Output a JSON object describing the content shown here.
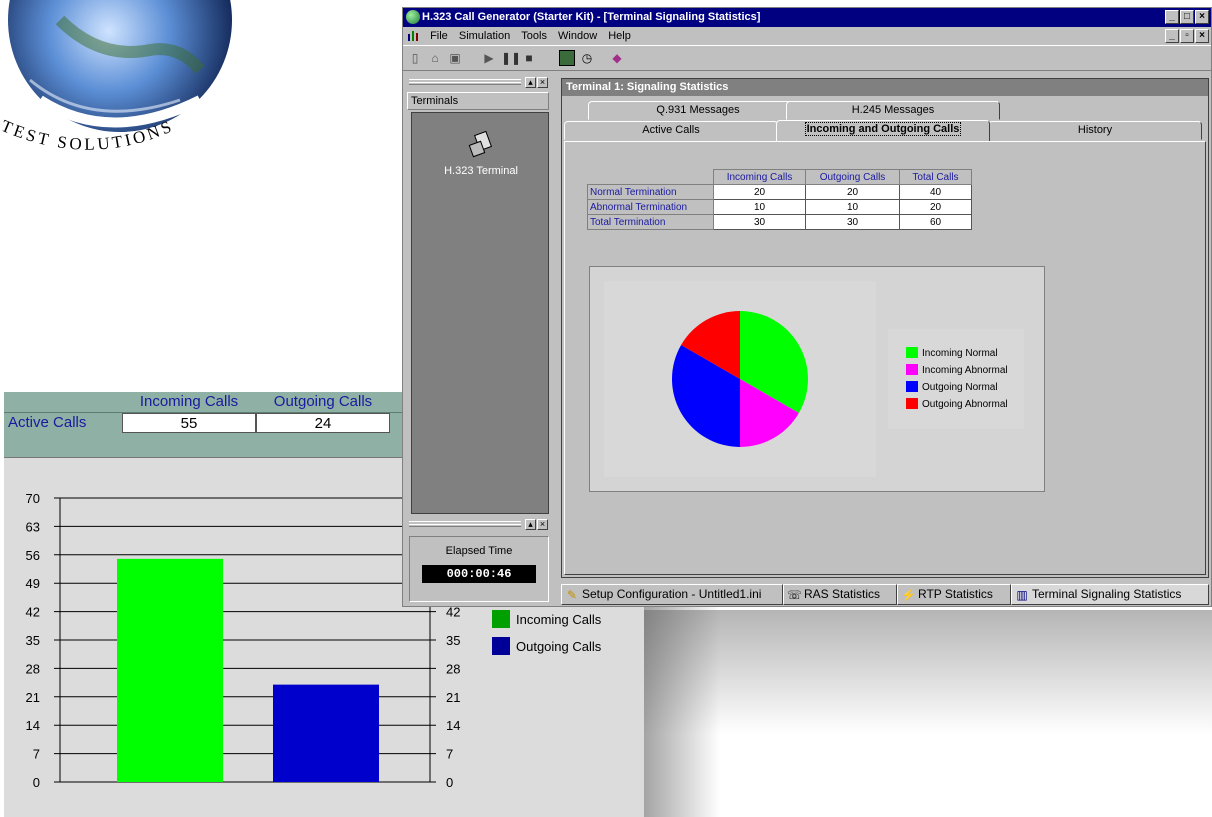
{
  "logo": {
    "text": "K TEST SOLUTIONS"
  },
  "active_calls_window": {
    "headers": [
      "Incoming Calls",
      "Outgoing Calls"
    ],
    "row_label": "Active Calls",
    "values": [
      "55",
      "24"
    ],
    "legend": [
      "Incoming Calls",
      "Outgoing Calls"
    ]
  },
  "app": {
    "title": "H.323 Call Generator (Starter Kit) - [Terminal Signaling Statistics]",
    "menu": [
      "File",
      "Simulation",
      "Tools",
      "Window",
      "Help"
    ],
    "terminals_header": "Terminals",
    "terminal_item": "H.323 Terminal",
    "elapsed_label": "Elapsed Time",
    "elapsed_value": "000:00:46",
    "child_title": "Terminal 1: Signaling Statistics",
    "tabs_row1": [
      "Q.931 Messages",
      "H.245 Messages"
    ],
    "tabs_row2": [
      "Active Calls",
      "Incoming and Outgoing Calls",
      "History"
    ],
    "stats_table": {
      "columns": [
        "Incoming Calls",
        "Outgoing Calls",
        "Total Calls"
      ],
      "rows": [
        {
          "label": "Normal Termination",
          "values": [
            "20",
            "20",
            "40"
          ]
        },
        {
          "label": "Abnormal Termination",
          "values": [
            "10",
            "10",
            "20"
          ]
        },
        {
          "label": "Total Termination",
          "values": [
            "30",
            "30",
            "60"
          ]
        }
      ]
    },
    "bottom_tabs": [
      "Setup Configuration - Untitled1.ini",
      "RAS Statistics",
      "RTP Statistics",
      "Terminal Signaling Statistics"
    ]
  },
  "colors": {
    "green": "#00ff00",
    "magenta": "#ff00ff",
    "blue": "#0000ff",
    "red": "#ff0000",
    "navy": "#000080",
    "bar_green": "#00ff00",
    "bar_blue": "#0000cc"
  },
  "chart_data": [
    {
      "type": "pie",
      "categories": [
        "Incoming Normal",
        "Incoming Abnormal",
        "Outgoing Normal",
        "Outgoing Abnormal"
      ],
      "values": [
        20,
        10,
        20,
        10
      ],
      "colors": [
        "#00ff00",
        "#ff00ff",
        "#0000ff",
        "#ff0000"
      ],
      "legend_position": "right"
    },
    {
      "type": "bar",
      "categories": [
        "Incoming Calls",
        "Outgoing Calls"
      ],
      "values": [
        55,
        24
      ],
      "colors": [
        "#00ff00",
        "#0000cc"
      ],
      "ylim": [
        0,
        70
      ],
      "yticks": [
        0,
        7,
        14,
        21,
        28,
        35,
        42,
        49,
        56,
        63,
        70
      ],
      "right_yticks_visible": [
        0,
        7,
        14,
        21,
        28,
        35,
        42
      ],
      "grid": true,
      "legend_position": "right"
    }
  ]
}
